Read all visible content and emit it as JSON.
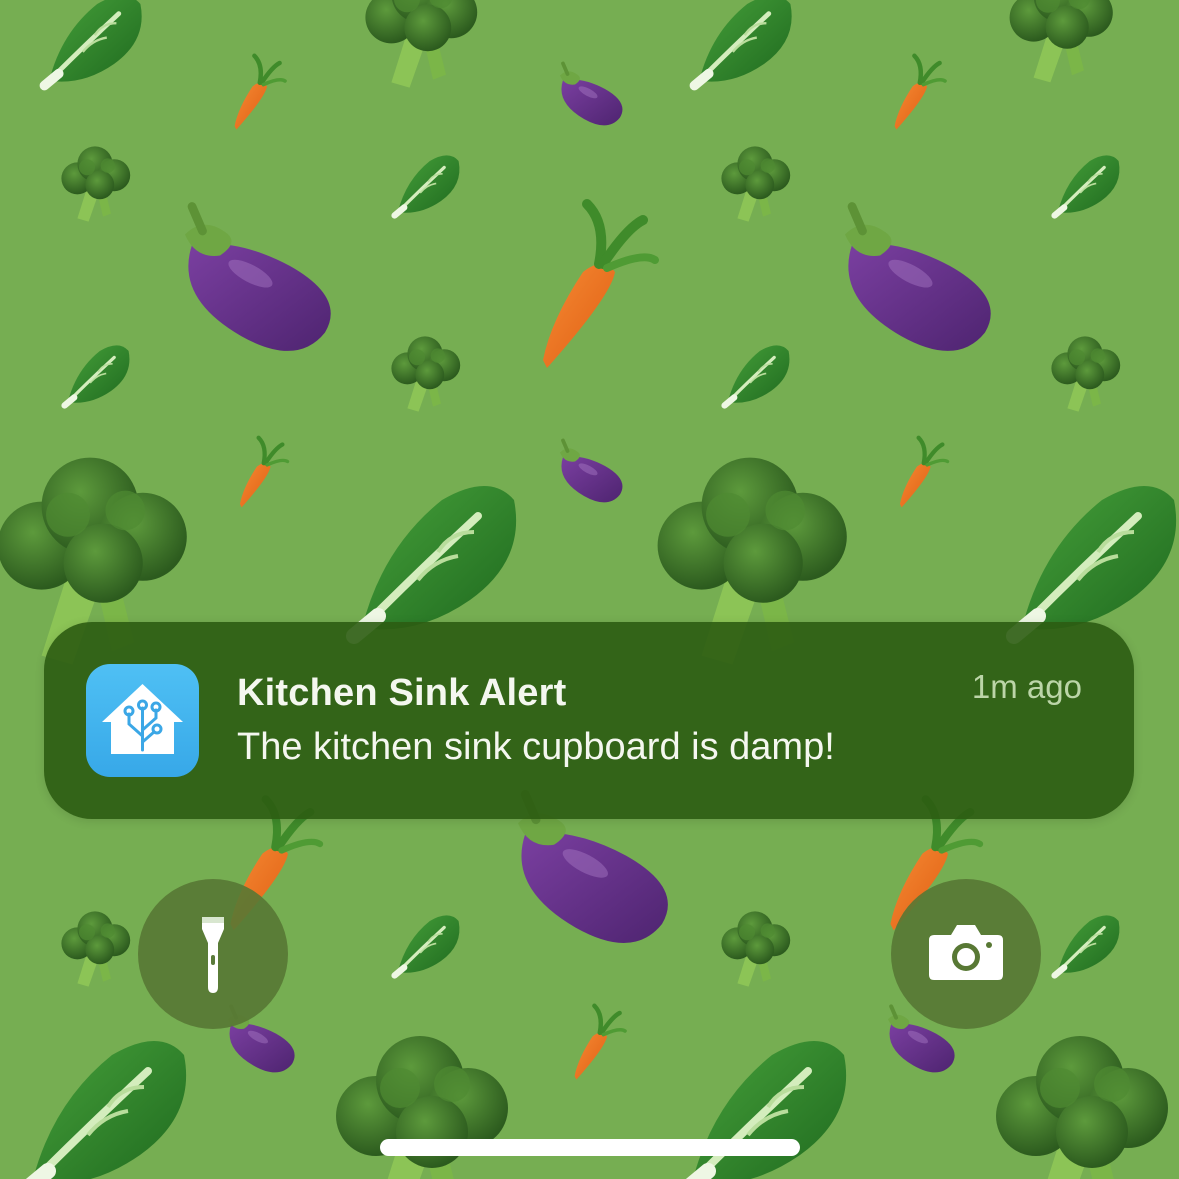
{
  "wallpaper": {
    "background_color": "#76ae52",
    "pattern": [
      "broccoli",
      "carrot",
      "eggplant",
      "leafy-green"
    ]
  },
  "notification": {
    "app_icon": "home-assistant-icon",
    "title": "Kitchen Sink Alert",
    "body": "The kitchen sink cupboard is damp!",
    "time": "1m ago",
    "background_color": "#2c5c12"
  },
  "quick_actions": {
    "flashlight_icon": "flashlight-icon",
    "camera_icon": "camera-icon"
  },
  "home_indicator": {
    "color": "#ffffff"
  }
}
